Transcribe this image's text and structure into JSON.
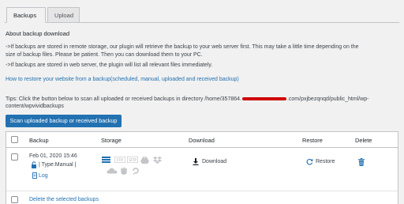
{
  "tabs": [
    {
      "label": "Backups"
    },
    {
      "label": "Upload"
    }
  ],
  "about": {
    "heading": "About backup download",
    "line1": "->If backups are stored in remote storage, our plugin will retrieve the backup to your web server first. This may take a little time depending on the",
    "line2": "size of backup files. Please be patient. Then you can download them to your PC.",
    "line3": "->If backups are stored in web server, the plugin will list all relevant files immediately."
  },
  "restore_link": "How to restore your website from a backup(scheduled, manual, uploaded and received backup)",
  "tips": {
    "line1_a": "Tips: Click the button below to scan all uploaded or received backups in directory /home/357864.",
    "line1_b": ".com/pxjbezqnqd/public_html/wp-",
    "line2": "content/wpvividbackups"
  },
  "scan_button": "Scan uploaded backup or received backup",
  "table": {
    "headers": {
      "backup": "Backup",
      "storage": "Storage",
      "download": "Download",
      "restore": "Restore",
      "delete": "Delete"
    },
    "rows": [
      {
        "date": "Feb 01, 2020 15:46",
        "type": "| Type:Manual |",
        "log": "Log",
        "download": "Download",
        "restore": "Restore"
      }
    ],
    "footer_link": "Delete the selected backups"
  },
  "storage_icons": [
    "local-storage-icon",
    "ftp-icon",
    "sftp-icon",
    "google-drive-icon",
    "dropbox-icon",
    "onedrive-icon",
    "amazon-s3-icon",
    "digitalocean-icon"
  ],
  "colors": {
    "accent": "#2271b1",
    "redaction": "#d00000"
  }
}
